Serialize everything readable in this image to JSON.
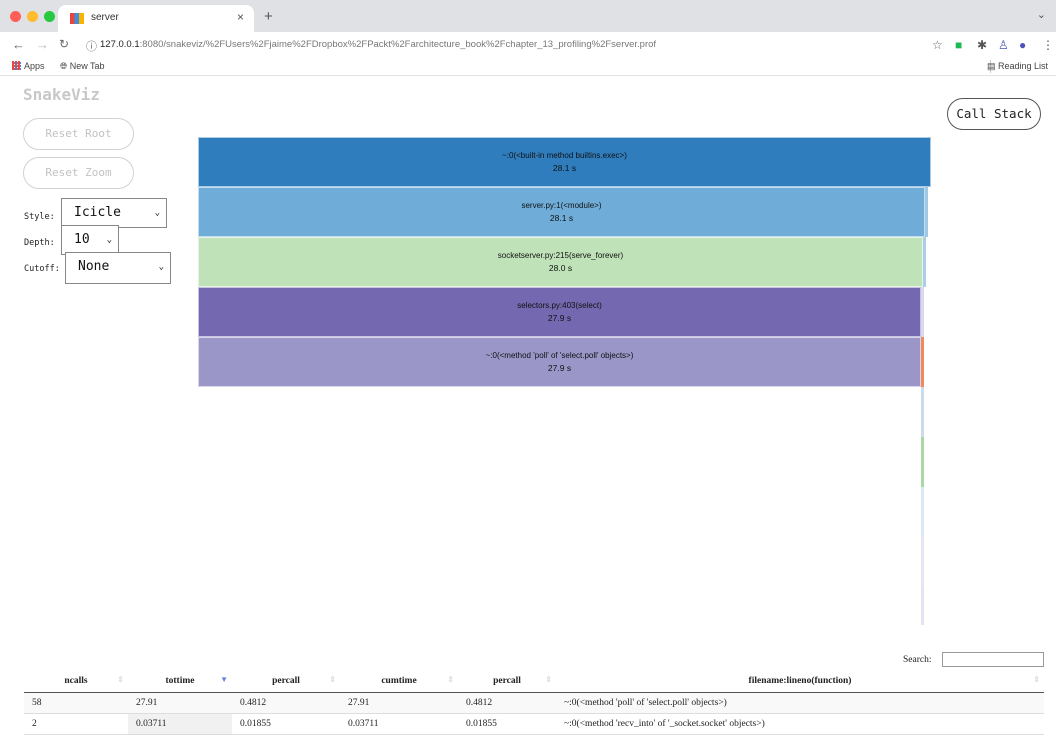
{
  "browser": {
    "tab_title": "server",
    "tab_close": "×",
    "new_tab": "+",
    "url_host": "127.0.0.1",
    "url_rest": ":8080/snakeviz/%2FUsers%2Fjaime%2FDropbox%2FPackt%2Farchitecture_book%2Fchapter_13_profiling%2Fserver.prof",
    "bookmarks": [
      "Apps",
      "New Tab"
    ],
    "reading_list": "Reading List",
    "traffic_lights": [
      "#ff5f57",
      "#febc2e",
      "#28c840"
    ]
  },
  "snakeviz": {
    "logo": "SnakeViz",
    "reset_root": "Reset Root",
    "reset_zoom": "Reset Zoom",
    "style_label": "Style:",
    "style_value": "Icicle",
    "depth_label": "Depth:",
    "depth_value": "10",
    "cutoff_label": "Cutoff:",
    "cutoff_value": "None",
    "call_stack": "Call Stack"
  },
  "icicle": [
    {
      "name": "~:0(<built-in method builtins.exec>)",
      "time": "28.1 s",
      "color": "#2f7dbd"
    },
    {
      "name": "server.py:1(<module>)",
      "time": "28.1 s",
      "color": "#6fadd8"
    },
    {
      "name": "socketserver.py:215(serve_forever)",
      "time": "28.0 s",
      "color": "#bfe2b9"
    },
    {
      "name": "selectors.py:403(select)",
      "time": "27.9 s",
      "color": "#7468b0"
    },
    {
      "name": "~:0(<method 'poll' of 'select.poll' objects>)",
      "time": "27.9 s",
      "color": "#9a96c8"
    }
  ],
  "table": {
    "search_label": "Search:",
    "columns": [
      "ncalls",
      "tottime",
      "percall",
      "cumtime",
      "percall",
      "filename:lineno(function)"
    ],
    "rows": [
      [
        "58",
        "27.91",
        "0.4812",
        "27.91",
        "0.4812",
        "~:0(<method 'poll' of 'select.poll' objects>)"
      ],
      [
        "2",
        "0.03711",
        "0.01855",
        "0.03711",
        "0.01855",
        "~:0(<method 'recv_into' of '_socket.socket' objects>)"
      ]
    ]
  }
}
